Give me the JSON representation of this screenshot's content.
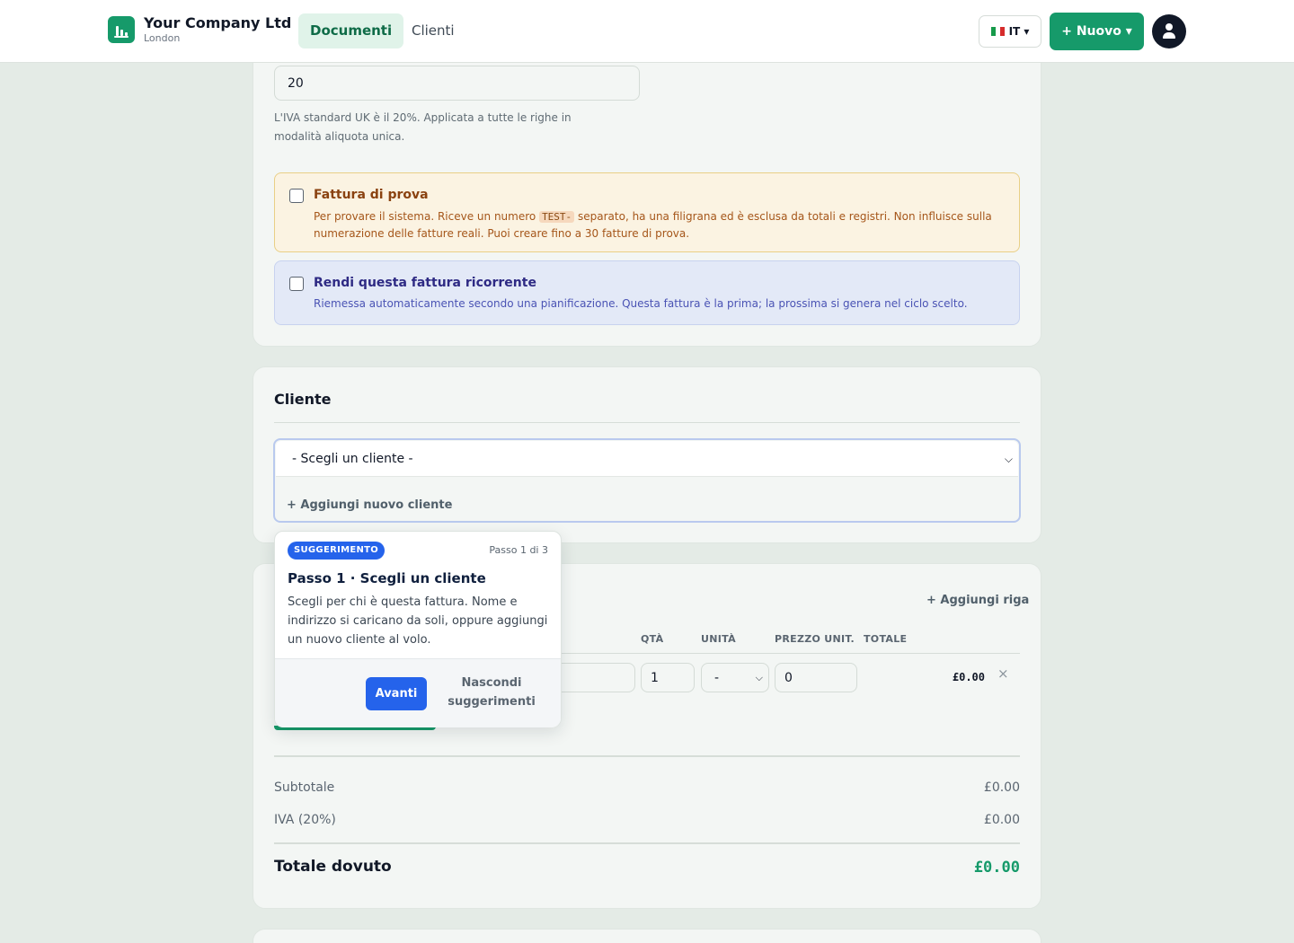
{
  "brand": {
    "name": "Your Company Ltd",
    "city": "London"
  },
  "nav": {
    "tabs": [
      {
        "label": "Documenti"
      },
      {
        "label": "Clienti"
      }
    ]
  },
  "header": {
    "lang": "IT ▾",
    "new_label": "+ Nuovo ▾"
  },
  "tax": {
    "rate_value": "20",
    "helper": "L'IVA standard UK è il 20%. Applicata a tutte le righe in modalità aliquota unica."
  },
  "trial": {
    "title": "Fattura di prova",
    "text_before": "Per provare il sistema. Riceve un numero ",
    "tag": "TEST-",
    "text_after": " separato, ha una filigrana ed è esclusa da totali e registri. Non influisce sulla numerazione delle fatture reali. Puoi creare fino a 30 fatture di prova."
  },
  "recurring": {
    "title": "Rendi questa fattura ricorrente",
    "text": "Riemessa automaticamente secondo una pianificazione. Questa fattura è la prima; la prossima si genera nel ciclo scelto."
  },
  "client": {
    "section_title": "Cliente",
    "select_value": "- Scegli un cliente -",
    "add_label": "+ Aggiungi nuovo cliente"
  },
  "lines": {
    "add_row_label": "+ Aggiungi riga",
    "columns": {
      "qty": "QTÀ",
      "unit": "UNITÀ",
      "unit_price": "PREZZO UNIT.",
      "total": "TOTALE"
    },
    "row": {
      "qty": "1",
      "unit": "-",
      "price": "0",
      "total": "£0.00",
      "remove": "×"
    }
  },
  "totals": {
    "subtotal_label": "Subtotale",
    "subtotal_value": "£0.00",
    "vat_label": "IVA (20%)",
    "vat_value": "£0.00",
    "due_label": "Totale dovuto",
    "due_value": "£0.00"
  },
  "tip": {
    "badge": "SUGGERIMENTO",
    "step": "Passo 1 di 3",
    "title": "Passo 1 · Scegli un cliente",
    "body": "Scegli per chi è questa fattura. Nome e indirizzo si caricano da soli, oppure aggiungi un nuovo cliente al volo.",
    "next": "Avanti",
    "hide": "Nascondi suggerimenti"
  },
  "colors": {
    "brand_green": "#169a6a",
    "accent_blue": "#2563eb",
    "trial_bg": "#fbf3e2",
    "recurring_bg": "#e3e9f7"
  }
}
